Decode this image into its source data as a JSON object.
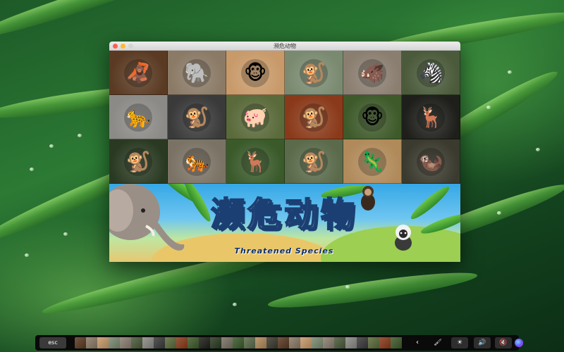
{
  "window": {
    "title": "濒危动物"
  },
  "banner": {
    "title_cn": "濒危动物",
    "title_en": "Threatened Species"
  },
  "animals": [
    {
      "icon": "orangutan-icon",
      "glyph": "🦧",
      "bg": "#5a3a22"
    },
    {
      "icon": "elephant-icon",
      "glyph": "🐘",
      "bg": "#8a7a66"
    },
    {
      "icon": "proboscis-monkey-icon",
      "glyph": "🐵",
      "bg": "#c89a6a"
    },
    {
      "icon": "monkey-icon",
      "glyph": "🐒",
      "bg": "#7a8a70"
    },
    {
      "icon": "tapir-icon",
      "glyph": "🐗",
      "bg": "#8a7e70"
    },
    {
      "icon": "okapi-icon",
      "glyph": "🦓",
      "bg": "#4a5a3a"
    },
    {
      "icon": "jaguar-icon",
      "glyph": "🐆",
      "bg": "#8b8a86"
    },
    {
      "icon": "tamarin-icon",
      "glyph": "🐒",
      "bg": "#3a3a3a"
    },
    {
      "icon": "malayan-tapir-icon",
      "glyph": "🐖",
      "bg": "#5a6a3a"
    },
    {
      "icon": "lemur-icon",
      "glyph": "🐒",
      "bg": "#8a3a1a"
    },
    {
      "icon": "lion-tailed-macaque-icon",
      "glyph": "🐵",
      "bg": "#3e5a2a"
    },
    {
      "icon": "deer-icon",
      "glyph": "🦌",
      "bg": "#1e1e1a"
    },
    {
      "icon": "chimpanzee-icon",
      "glyph": "🐒",
      "bg": "#2a3a22"
    },
    {
      "icon": "white-tiger-icon",
      "glyph": "🐅",
      "bg": "#7a7264"
    },
    {
      "icon": "antelope-icon",
      "glyph": "🦌",
      "bg": "#3a5a2a"
    },
    {
      "icon": "colobus-monkey-icon",
      "glyph": "🐒",
      "bg": "#5a6a4a"
    },
    {
      "icon": "komodo-dragon-icon",
      "glyph": "🦎",
      "bg": "#b08a5a"
    },
    {
      "icon": "otter-icon",
      "glyph": "🦦",
      "bg": "#3a3a2e"
    }
  ],
  "touchbar": {
    "esc_label": "esc",
    "chevron": "‹",
    "brush": "🖌",
    "brightness": "☀",
    "volume": "🔊",
    "mute": "🔇"
  },
  "colors": {
    "banner_title": "#dff2fb",
    "banner_title_outline": "#1c3f73",
    "banner_subtitle": "#0e2f6b"
  }
}
